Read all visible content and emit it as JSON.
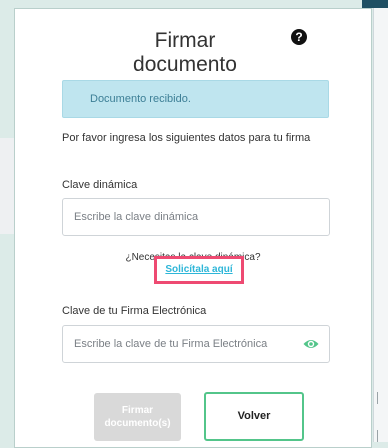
{
  "dialog": {
    "title_line1": "Firmar",
    "title_line2": "documento",
    "help_icon": "?",
    "alert": "Documento recibido.",
    "instructions": "Por favor ingresa los siguientes datos para tu firma"
  },
  "dynamic_key": {
    "label": "Clave dinámica",
    "placeholder": "Escribe la clave dinámica",
    "help_text": "¿Necesitas la clave dinámica?",
    "link": "Solicítala aquí"
  },
  "signature_key": {
    "label": "Clave de tu Firma Electrónica",
    "placeholder": "Escribe la clave de tu Firma Electrónica",
    "eye_icon": "eye-icon"
  },
  "buttons": {
    "sign_line1": "Firmar",
    "sign_line2": "documento(s)",
    "back": "Volver"
  },
  "colors": {
    "accent_green": "#53c58a",
    "link": "#2db6d8",
    "highlight": "#ee4a72",
    "alert_bg": "#bfe5ef"
  }
}
